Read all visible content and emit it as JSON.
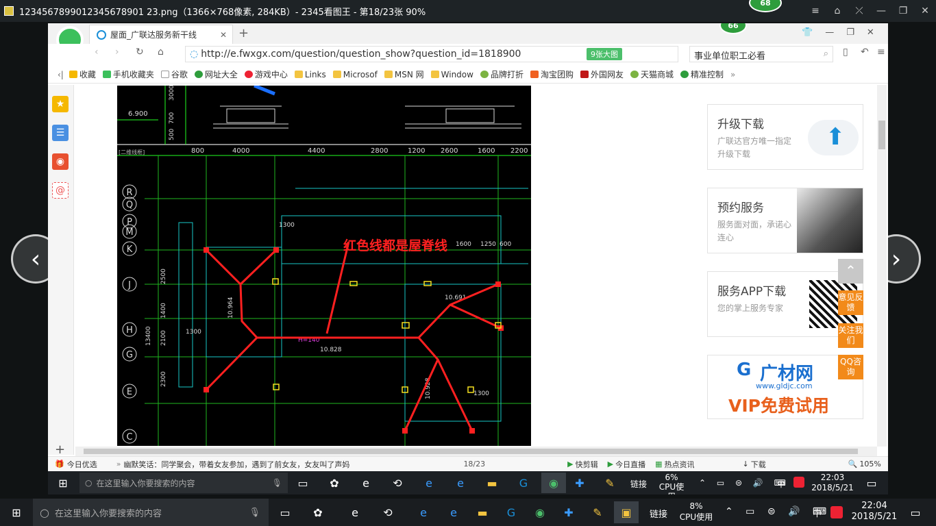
{
  "viewer": {
    "title": "1234567899012345678901 23.png（1366×768像素, 284KB）- 2345看图王 - 第18/23张 90%",
    "badge": "68",
    "controls": [
      "≡",
      "⌂",
      "⤫",
      "—",
      "❐",
      "✕"
    ]
  },
  "browser": {
    "tab_title": "屋面_广联达服务新干线",
    "new_tab": "+",
    "badge": "66",
    "url": "http://e.fwxgx.com/question/question_show?question_id=1818900",
    "big_pic_button": "9张大图",
    "search_text": "事业单位职工必看",
    "bookmarks": [
      "收藏",
      "手机收藏夹",
      "谷歌",
      "网址大全",
      "游戏中心",
      "Links",
      "Microsof",
      "MSN 网",
      "Window",
      "品牌打折",
      "淘宝团购",
      "外国网友",
      "天猫商城",
      "精准控制"
    ]
  },
  "cad": {
    "annotation": "红色线都是屋脊线",
    "top_dims": [
      "800",
      "4000",
      "4400",
      "2800",
      "1200",
      "2600",
      "1600",
      "2200"
    ],
    "rows": [
      "R",
      "Q",
      "P",
      "M",
      "K",
      "J",
      "H",
      "G",
      "E",
      "C"
    ],
    "dims": [
      "1300",
      "1600",
      "1250",
      "600",
      "10.964",
      "10.691",
      "10.828",
      "10.928",
      "H=140",
      "2000",
      "2500",
      "1400",
      "2100",
      "2300",
      "1300",
      "1300",
      "6.900",
      "3000",
      "700",
      "500",
      "13400"
    ],
    "left_label": "[二维线框]"
  },
  "right_panels": [
    {
      "title": "升级下载",
      "sub": "广联达官方唯一指定升级下载"
    },
    {
      "title": "预约服务",
      "sub": "服务面对面，承诺心连心"
    },
    {
      "title": "服务APP下载",
      "sub": "您的掌上服务专家"
    }
  ],
  "ad": {
    "brand": "广材网",
    "url": "www.gldjc.com",
    "slogan": "VIP免费试用"
  },
  "float_buttons": [
    "意见反馈",
    "关注我们",
    "QQ咨询"
  ],
  "statusbar": {
    "left": "今日优选",
    "news": "幽默笑话：同学聚会，带着女友参加，遇到了前女友，女友叫了声妈",
    "page": "18/23",
    "items": [
      "快剪辑",
      "今日直播",
      "热点资讯",
      "下载"
    ],
    "zoom": "105%"
  },
  "inner_taskbar": {
    "search": "在这里输入你要搜索的内容",
    "link": "链接",
    "cpu_pct": "6%",
    "cpu_label": "CPU使用",
    "ime": "中",
    "time": "22:03",
    "date": "2018/5/21"
  },
  "taskbar": {
    "search": "在这里输入你要搜索的内容",
    "link": "链接",
    "cpu_pct": "8%",
    "cpu_label": "CPU使用",
    "ime": "中",
    "time": "22:04",
    "date": "2018/5/21"
  },
  "colors": {
    "accent": "#4cbf6b",
    "orange": "#f28a1a",
    "ridge_red": "#ff2020"
  }
}
